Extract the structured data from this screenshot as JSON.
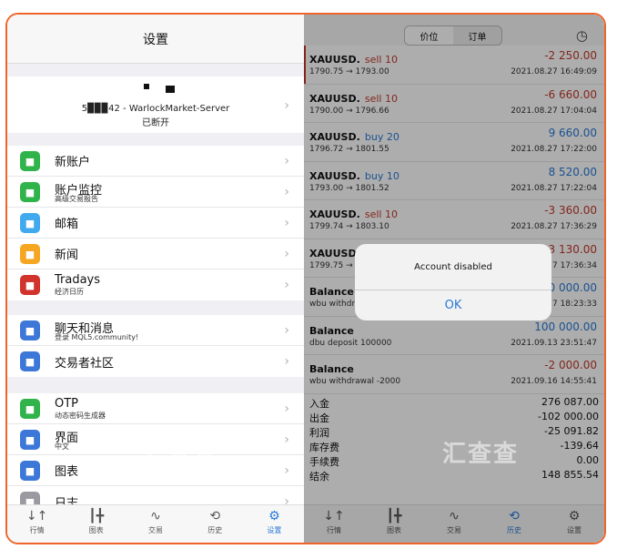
{
  "settings": {
    "title": "设置",
    "account": {
      "line1": "5▉▉▉42 - WarlockMarket-Server",
      "line2": "已断开"
    },
    "group1": [
      {
        "label": "新账户",
        "sub": "",
        "icon": "new-account-icon",
        "color": "#2fb34a"
      },
      {
        "label": "账户监控",
        "sub": "高级交易报告",
        "icon": "monitoring-icon",
        "color": "#2fb34a"
      },
      {
        "label": "邮箱",
        "sub": "",
        "icon": "mail-icon",
        "color": "#41a9ee"
      },
      {
        "label": "新闻",
        "sub": "",
        "icon": "news-icon",
        "color": "#f5a623"
      },
      {
        "label": "Tradays",
        "sub": "经济日历",
        "icon": "tradays-icon",
        "color": "#d0342c"
      }
    ],
    "group2": [
      {
        "label": "聊天和消息",
        "sub": "登录 MQL5.community!",
        "icon": "chat-icon",
        "color": "#3d78d8"
      },
      {
        "label": "交易者社区",
        "sub": "",
        "icon": "mql5-icon",
        "color": "#3d78d8"
      }
    ],
    "group3": [
      {
        "label": "OTP",
        "sub": "动态密码生成器",
        "icon": "otp-icon",
        "color": "#2fb34a"
      },
      {
        "label": "界面",
        "sub": "中文",
        "icon": "language-icon",
        "color": "#3d78d8"
      },
      {
        "label": "图表",
        "sub": "",
        "icon": "chart-icon",
        "color": "#3d78d8"
      },
      {
        "label": "日志",
        "sub": "",
        "icon": "journal-icon",
        "color": "#9a9aa0"
      }
    ]
  },
  "tabs": [
    {
      "label": "行情",
      "glyph": "↓↑"
    },
    {
      "label": "图表",
      "glyph": "┃╋"
    },
    {
      "label": "交易",
      "glyph": "∿"
    },
    {
      "label": "历史",
      "glyph": "⟲"
    },
    {
      "label": "设置",
      "glyph": "⚙"
    }
  ],
  "history": {
    "segments": [
      "价位",
      "订单"
    ],
    "deals": [
      {
        "sym": "XAUUSD.",
        "dir": "sell 10",
        "type": "sell",
        "prices": "1790.75 → 1793.00",
        "pl": "-2 250.00",
        "time": "2021.08.27 16:49:09"
      },
      {
        "sym": "XAUUSD.",
        "dir": "sell 10",
        "type": "sell",
        "prices": "1790.00 → 1796.66",
        "pl": "-6 660.00",
        "time": "2021.08.27 17:04:04"
      },
      {
        "sym": "XAUUSD.",
        "dir": "buy 20",
        "type": "buy",
        "prices": "1796.72 → 1801.55",
        "pl": "9 660.00",
        "time": "2021.08.27 17:22:00"
      },
      {
        "sym": "XAUUSD.",
        "dir": "buy 10",
        "type": "buy",
        "prices": "1793.00 → 1801.52",
        "pl": "8 520.00",
        "time": "2021.08.27 17:22:04"
      },
      {
        "sym": "XAUUSD.",
        "dir": "sell 10",
        "type": "sell",
        "prices": "1799.74 → 1803.10",
        "pl": "-3 360.00",
        "time": "2021.08.27 17:36:29"
      },
      {
        "sym": "XAUUSD.",
        "dir": "s",
        "type": "sell",
        "prices": "1799.75 →",
        "pl": "-3 130.00",
        "time": "27 17:36:34"
      },
      {
        "sym": "Balance",
        "dir": "",
        "type": "bal",
        "prices": "wbu withdra",
        "pl": "00 000.00",
        "time": "27 18:23:33"
      },
      {
        "sym": "Balance",
        "dir": "",
        "type": "bal",
        "prices": "dbu deposit 100000",
        "pl": "100 000.00",
        "time": "2021.09.13 23:51:47"
      },
      {
        "sym": "Balance",
        "dir": "",
        "type": "bal",
        "prices": "wbu withdrawal -2000",
        "pl": "-2 000.00",
        "time": "2021.09.16 14:55:41"
      }
    ],
    "summary": [
      {
        "k": "入金",
        "v": "276 087.00"
      },
      {
        "k": "出金",
        "v": "-102 000.00"
      },
      {
        "k": "利润",
        "v": "-25 091.82"
      },
      {
        "k": "库存费",
        "v": "-139.64"
      },
      {
        "k": "手续费",
        "v": "0.00"
      },
      {
        "k": "结余",
        "v": "148 855.54"
      }
    ]
  },
  "dialog": {
    "message": "Account disabled",
    "ok": "OK"
  },
  "watermark": "汇查查"
}
